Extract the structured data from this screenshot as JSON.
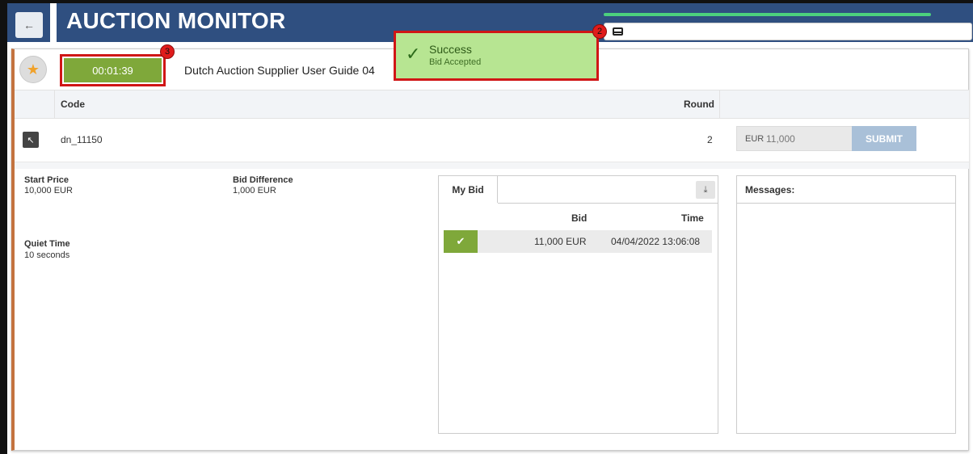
{
  "header": {
    "title": "AUCTION MONITOR",
    "back_icon": "arrow-left-icon",
    "inbox_icon": "inbox-icon"
  },
  "auction": {
    "timer": "00:01:39",
    "name": "Dutch Auction Supplier User Guide 04"
  },
  "table": {
    "columns": {
      "code": "Code",
      "round": "Round"
    },
    "row": {
      "code": "dn_11150",
      "round": "2",
      "bid_currency": "EUR",
      "bid_value": "11,000",
      "submit_label": "SUBMIT"
    }
  },
  "info": {
    "start_price_label": "Start Price",
    "start_price_value": "10,000 EUR",
    "bid_difference_label": "Bid Difference",
    "bid_difference_value": "1,000 EUR",
    "quiet_time_label": "Quiet Time",
    "quiet_time_value": "10 seconds"
  },
  "my_bid": {
    "tab_label": "My Bid",
    "col_bid": "Bid",
    "col_time": "Time",
    "rows": [
      {
        "amount": "11,000 EUR",
        "time": "04/04/2022 13:06:08"
      }
    ]
  },
  "messages": {
    "title": "Messages:"
  },
  "toast": {
    "title": "Success",
    "subtitle": "Bid Accepted"
  },
  "annotations": {
    "badge_2": "2",
    "badge_3": "3"
  },
  "colors": {
    "header_bg": "#2f4f80",
    "accent_green": "#7fa83a",
    "toast_bg": "#b7e592",
    "highlight_red": "#d01616",
    "panel_left_border": "#c3733f"
  }
}
